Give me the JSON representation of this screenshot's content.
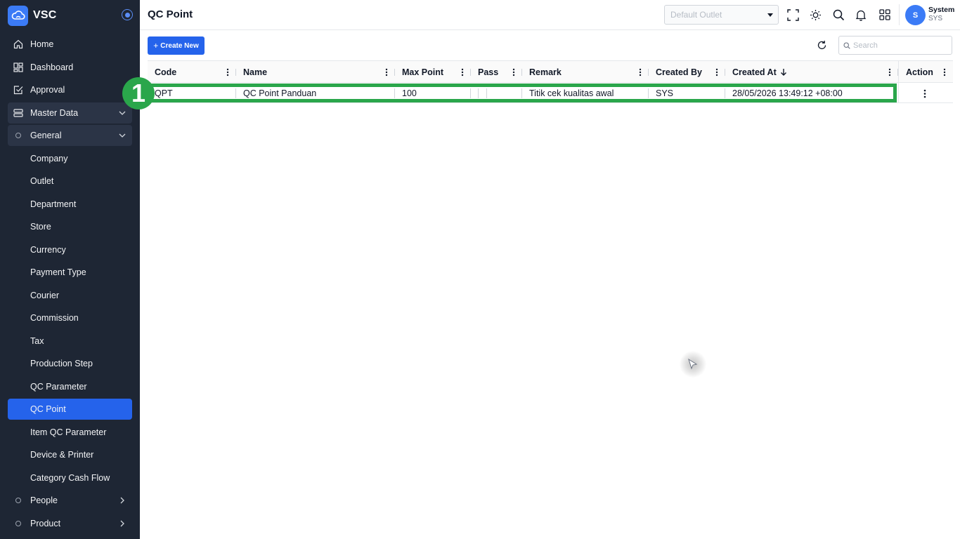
{
  "app": {
    "name": "VSC",
    "accent": "#2563eb",
    "sidebar_bg": "#1e2634",
    "highlight": "#2aa64b"
  },
  "sidebar": {
    "items": [
      {
        "label": "Home",
        "icon": "home-icon"
      },
      {
        "label": "Dashboard",
        "icon": "dashboard-icon"
      },
      {
        "label": "Approval",
        "icon": "approval-icon"
      },
      {
        "label": "Master Data",
        "icon": "database-icon",
        "expanded": true
      },
      {
        "label": "General",
        "icon": "circle-icon",
        "expanded": true
      }
    ],
    "sub_items": [
      "Company",
      "Outlet",
      "Department",
      "Store",
      "Currency",
      "Payment Type",
      "Courier",
      "Commission",
      "Tax",
      "Production Step",
      "QC Parameter",
      "QC Point",
      "Item QC Parameter",
      "Device & Printer",
      "Category Cash Flow"
    ],
    "active": "QC Point",
    "bottom_items": [
      {
        "label": "People",
        "icon": "circle-icon"
      },
      {
        "label": "Product",
        "icon": "circle-icon"
      }
    ]
  },
  "header": {
    "title": "QC Point",
    "outlet_placeholder": "Default Outlet",
    "user_name": "System",
    "user_code": "SYS",
    "avatar_initial": "S"
  },
  "toolbar": {
    "create_label": "Create New",
    "search_placeholder": "Search"
  },
  "table": {
    "columns": [
      "Code",
      "Name",
      "Max Point",
      "Pass",
      "Remark",
      "Created By",
      "Created At",
      "Action"
    ],
    "sort_column": "Created At",
    "rows": [
      {
        "code": "QPT",
        "name": "QC Point Panduan",
        "max_point": "100",
        "pass": "",
        "remark": "Titik cek kualitas awal",
        "created_by": "SYS",
        "created_at": "28/05/2026 13:49:12 +08:00"
      }
    ]
  },
  "annotation": {
    "badge": "1"
  }
}
